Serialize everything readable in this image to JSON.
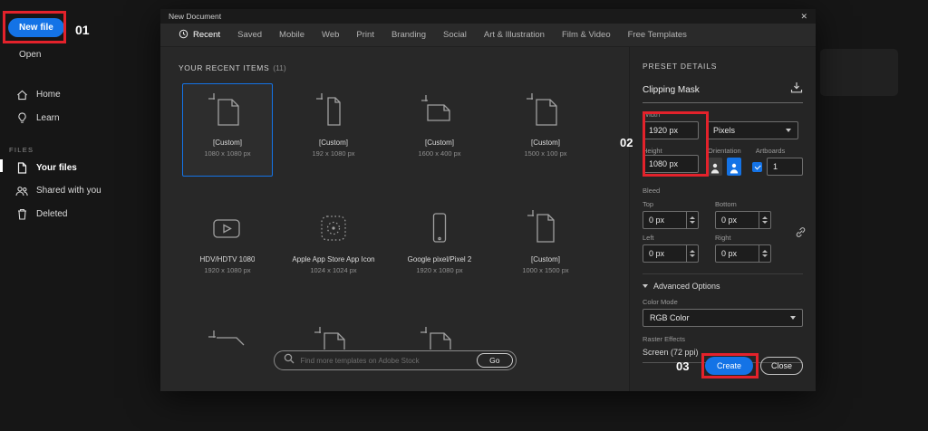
{
  "colors": {
    "accent": "#1473e6",
    "annotation": "#e3222b"
  },
  "steps": {
    "one": "01",
    "two": "02",
    "three": "03"
  },
  "sidebar": {
    "new_file_label": "New file",
    "open_label": "Open",
    "home_label": "Home",
    "learn_label": "Learn",
    "files_header": "FILES",
    "your_files_label": "Your files",
    "shared_label": "Shared with you",
    "deleted_label": "Deleted"
  },
  "dialog": {
    "title": "New Document",
    "close_glyph": "✕",
    "tabs": [
      "Recent",
      "Saved",
      "Mobile",
      "Web",
      "Print",
      "Branding",
      "Social",
      "Art & Illustration",
      "Film & Video",
      "Free Templates"
    ],
    "recent_header": "YOUR RECENT ITEMS",
    "recent_count": "(11)",
    "templates": [
      {
        "name": "[Custom]",
        "size": "1080 x 1080 px"
      },
      {
        "name": "[Custom]",
        "size": "192 x 1080 px"
      },
      {
        "name": "[Custom]",
        "size": "1600 x 400 px"
      },
      {
        "name": "[Custom]",
        "size": "1500 x 100 px"
      },
      {
        "name": "HDV/HDTV 1080",
        "size": "1920 x 1080 px"
      },
      {
        "name": "Apple App Store App Icon",
        "size": "1024 x 1024 px"
      },
      {
        "name": "Google pixel/Pixel 2",
        "size": "1920 x 1080 px"
      },
      {
        "name": "[Custom]",
        "size": "1000 x 1500 px"
      }
    ],
    "search": {
      "placeholder": "Find more templates on Adobe Stock",
      "go_label": "Go"
    },
    "preset": {
      "header": "PRESET DETAILS",
      "name_value": "Clipping Mask",
      "width_label": "Width",
      "width_value": "1920 px",
      "units_value": "Pixels",
      "height_label": "Height",
      "height_value": "1080 px",
      "orientation_label": "Orientation",
      "artboards_label": "Artboards",
      "artboards_value": "1",
      "bleed_label": "Bleed",
      "top_label": "Top",
      "bottom_label": "Bottom",
      "left_label": "Left",
      "right_label": "Right",
      "top_value": "0 px",
      "bottom_value": "0 px",
      "left_value": "0 px",
      "right_value": "0 px",
      "advanced_label": "Advanced Options",
      "color_mode_label": "Color Mode",
      "color_mode_value": "RGB Color",
      "raster_label": "Raster Effects",
      "raster_value": "Screen (72 ppi)",
      "create_label": "Create",
      "close_label": "Close"
    }
  }
}
